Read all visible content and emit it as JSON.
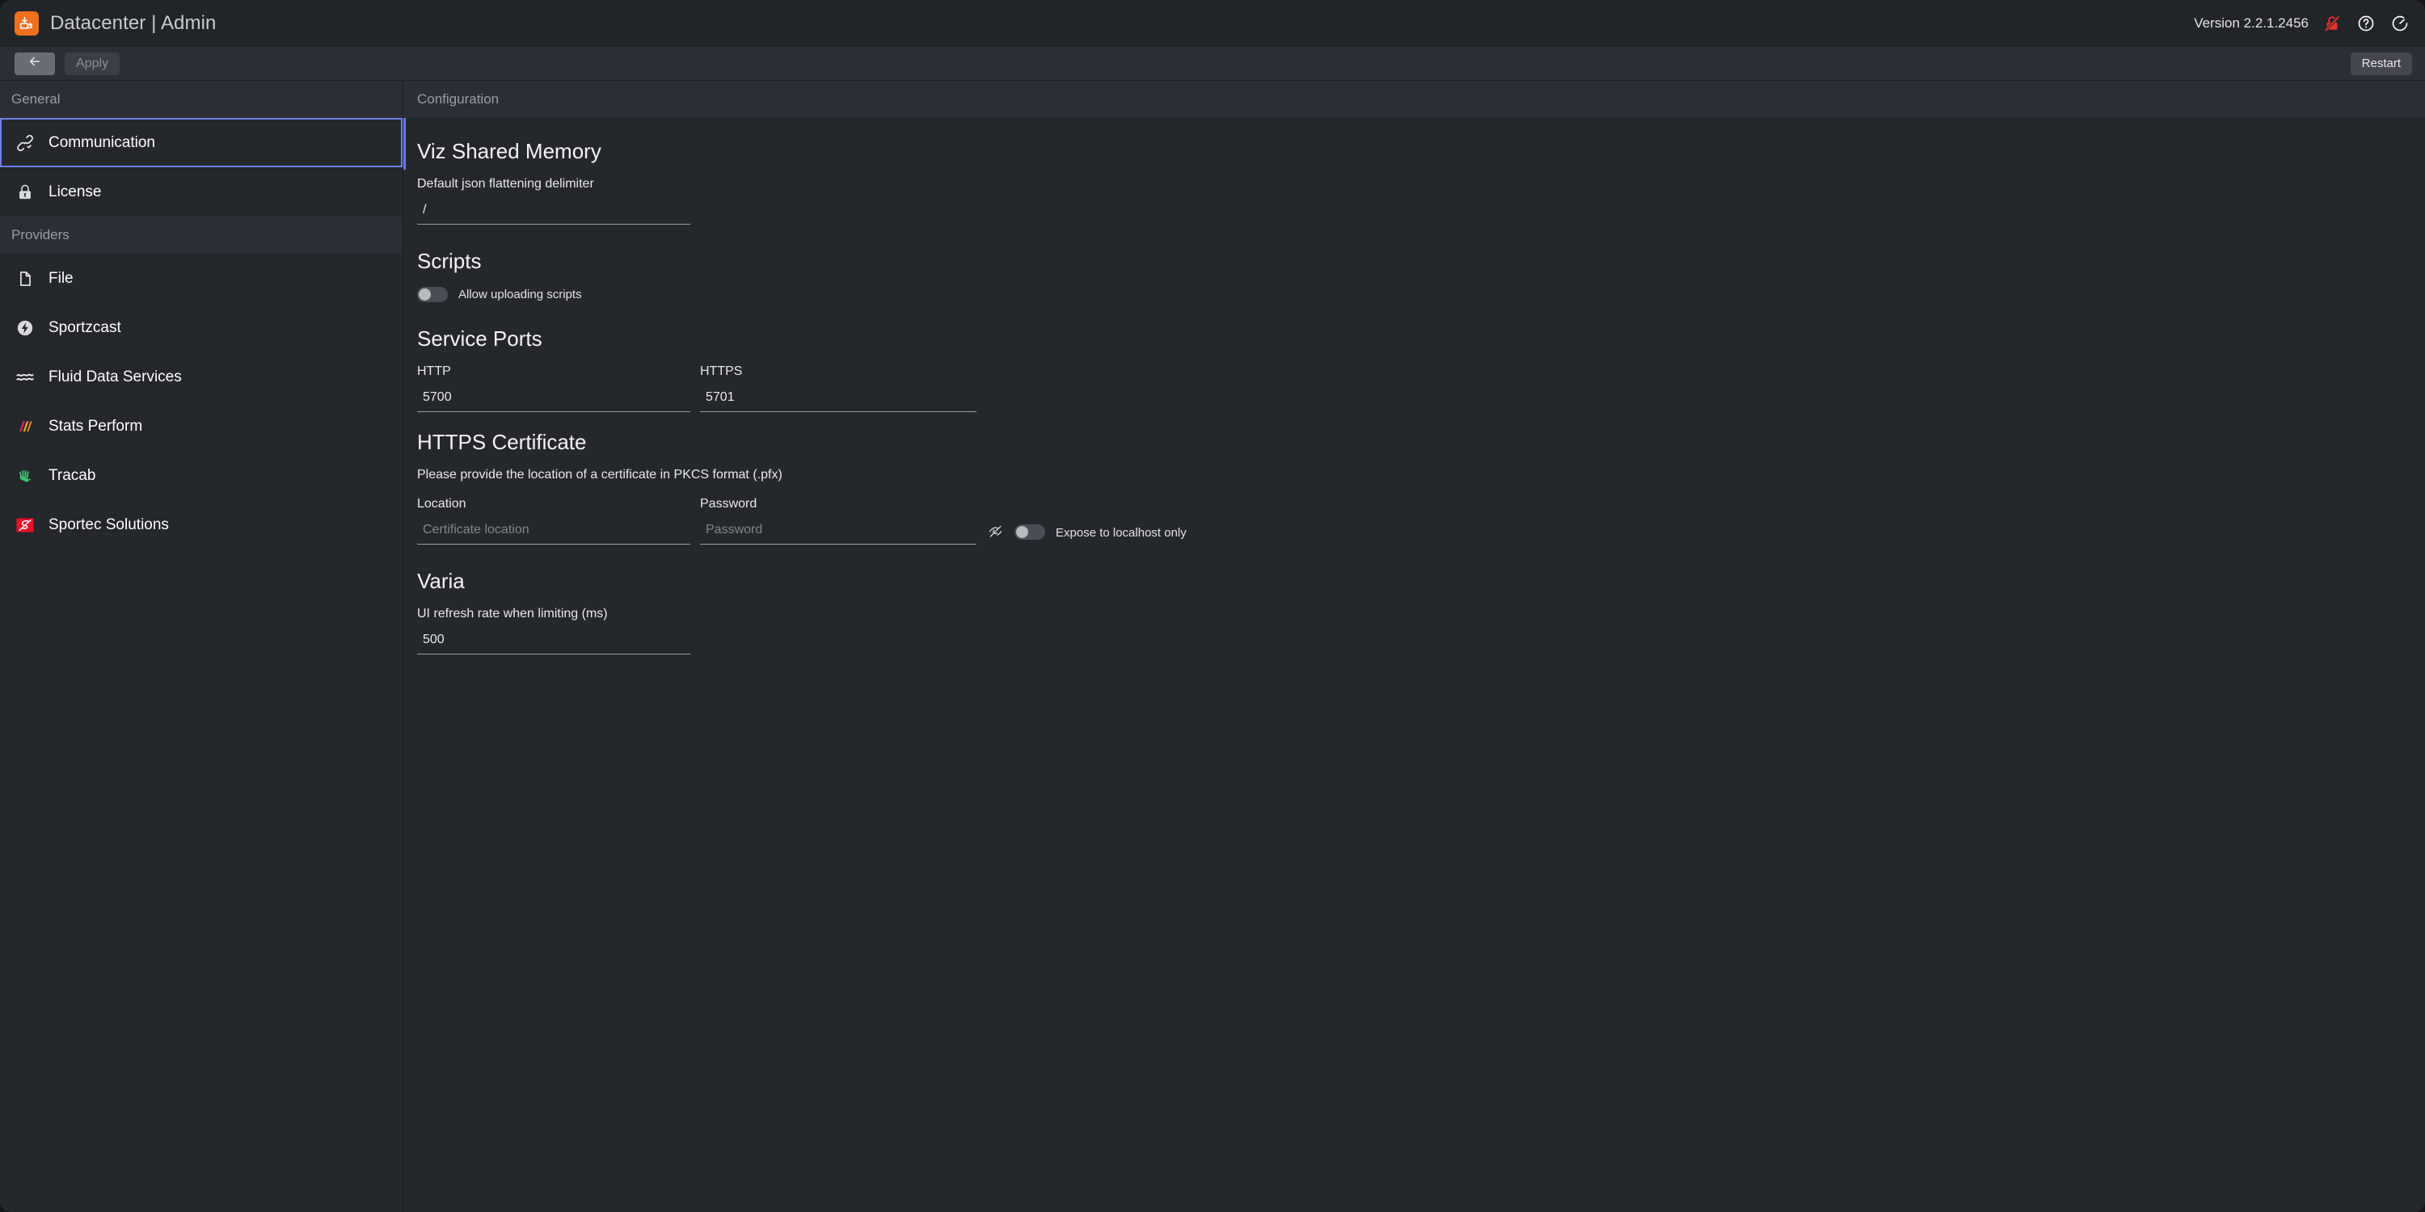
{
  "titlebar": {
    "logo_icon": "import-box-icon",
    "title": "Datacenter | Admin",
    "version": "Version 2.2.1.2456",
    "icons": [
      {
        "name": "lock-disabled-icon",
        "color": "#e8342c"
      },
      {
        "name": "help-circle-icon",
        "color": "#ffffff"
      },
      {
        "name": "speedometer-icon",
        "color": "#ffffff"
      }
    ]
  },
  "toolbar": {
    "back_icon": "arrow-left-icon",
    "apply_label": "Apply",
    "restart_label": "Restart"
  },
  "sidebar": {
    "groups": [
      {
        "header": "General",
        "items": [
          {
            "label": "Communication",
            "icon": "link-check-icon",
            "selected": true
          },
          {
            "label": "License",
            "icon": "lock-icon",
            "selected": false
          }
        ]
      },
      {
        "header": "Providers",
        "items": [
          {
            "label": "File",
            "icon": "file-icon",
            "selected": false
          },
          {
            "label": "Sportzcast",
            "icon": "bolt-circle-icon",
            "selected": false
          },
          {
            "label": "Fluid Data Services",
            "icon": "waves-icon",
            "selected": false
          },
          {
            "label": "Stats Perform",
            "icon": "stats-perform-slashes-icon",
            "selected": false
          },
          {
            "label": "Tracab",
            "icon": "hand-icon",
            "selected": false
          },
          {
            "label": "Sportec Solutions",
            "icon": "sportec-logo-icon",
            "selected": false
          }
        ]
      }
    ]
  },
  "content": {
    "header": "Configuration",
    "viz_shared_memory": {
      "title": "Viz Shared Memory",
      "delimiter_label": "Default json flattening delimiter",
      "delimiter_value": "/"
    },
    "scripts": {
      "title": "Scripts",
      "allow_upload_label": "Allow uploading scripts",
      "allow_upload_on": false
    },
    "service_ports": {
      "title": "Service Ports",
      "http_label": "HTTP",
      "http_value": "5700",
      "https_label": "HTTPS",
      "https_value": "5701"
    },
    "https_certificate": {
      "title": "HTTPS Certificate",
      "description": "Please provide the location of a certificate in PKCS format (.pfx)",
      "location_label": "Location",
      "location_placeholder": "Certificate location",
      "location_value": "",
      "password_label": "Password",
      "password_placeholder": "Password",
      "password_value": "",
      "reveal_icon": "eye-off-icon",
      "localhost_label": "Expose to localhost only",
      "localhost_on": false
    },
    "varia": {
      "title": "Varia",
      "refresh_label": "UI refresh rate when limiting (ms)",
      "refresh_value": "500"
    }
  },
  "colors": {
    "window_bg": "#24272c",
    "bar_bg": "#2b2e34",
    "titlebar_bg": "#212429",
    "accent": "#6b7ae0",
    "selection_border": "#7080e8",
    "logo_orange": "#f0701e",
    "danger_red": "#e8342c"
  }
}
